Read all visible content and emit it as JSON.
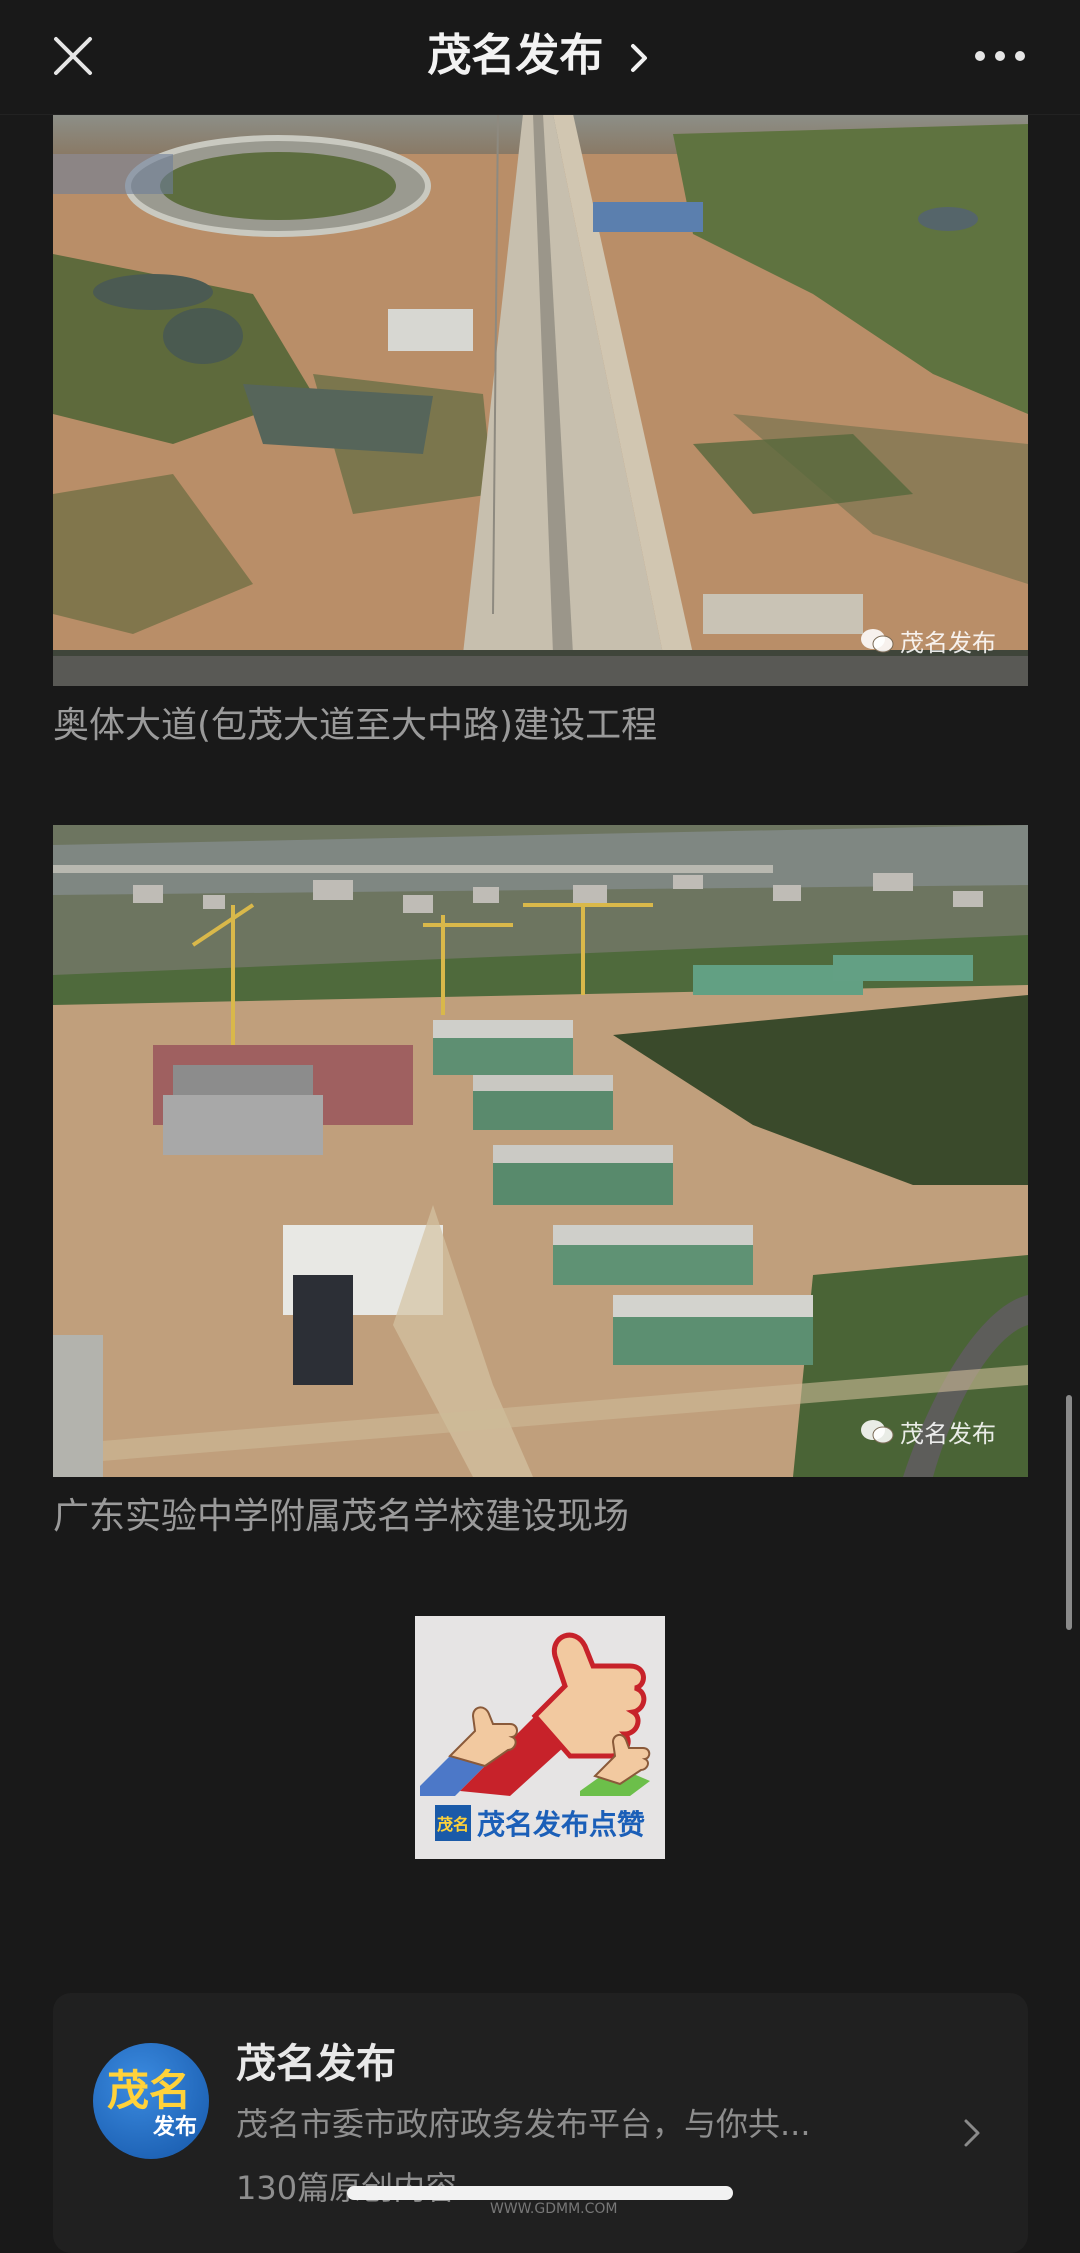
{
  "header": {
    "title": "茂名发布",
    "close_icon": "close-icon",
    "more_icon": "more-icon"
  },
  "article": {
    "watermark": "茂名发布",
    "photo1_caption": "奥体大道(包茂大道至大中路)建设工程",
    "photo2_caption": "广东实验中学附属茂名学校建设现场",
    "like_image_text": "茂名发布点赞",
    "like_image_logo": "茂名"
  },
  "account_card": {
    "avatar_text_top": "茂名",
    "avatar_text_bottom": "发布",
    "name": "茂名发布",
    "description": "茂名市委市政府政务发布平台，与你共...",
    "article_count": "130篇原创内容"
  },
  "footer": {
    "site_mark": "WWW.GDMM.COM"
  },
  "colors": {
    "background": "#191919",
    "card_background": "#202020",
    "caption_text": "#9a9a9a",
    "brand_blue": "#1a5aa8"
  }
}
